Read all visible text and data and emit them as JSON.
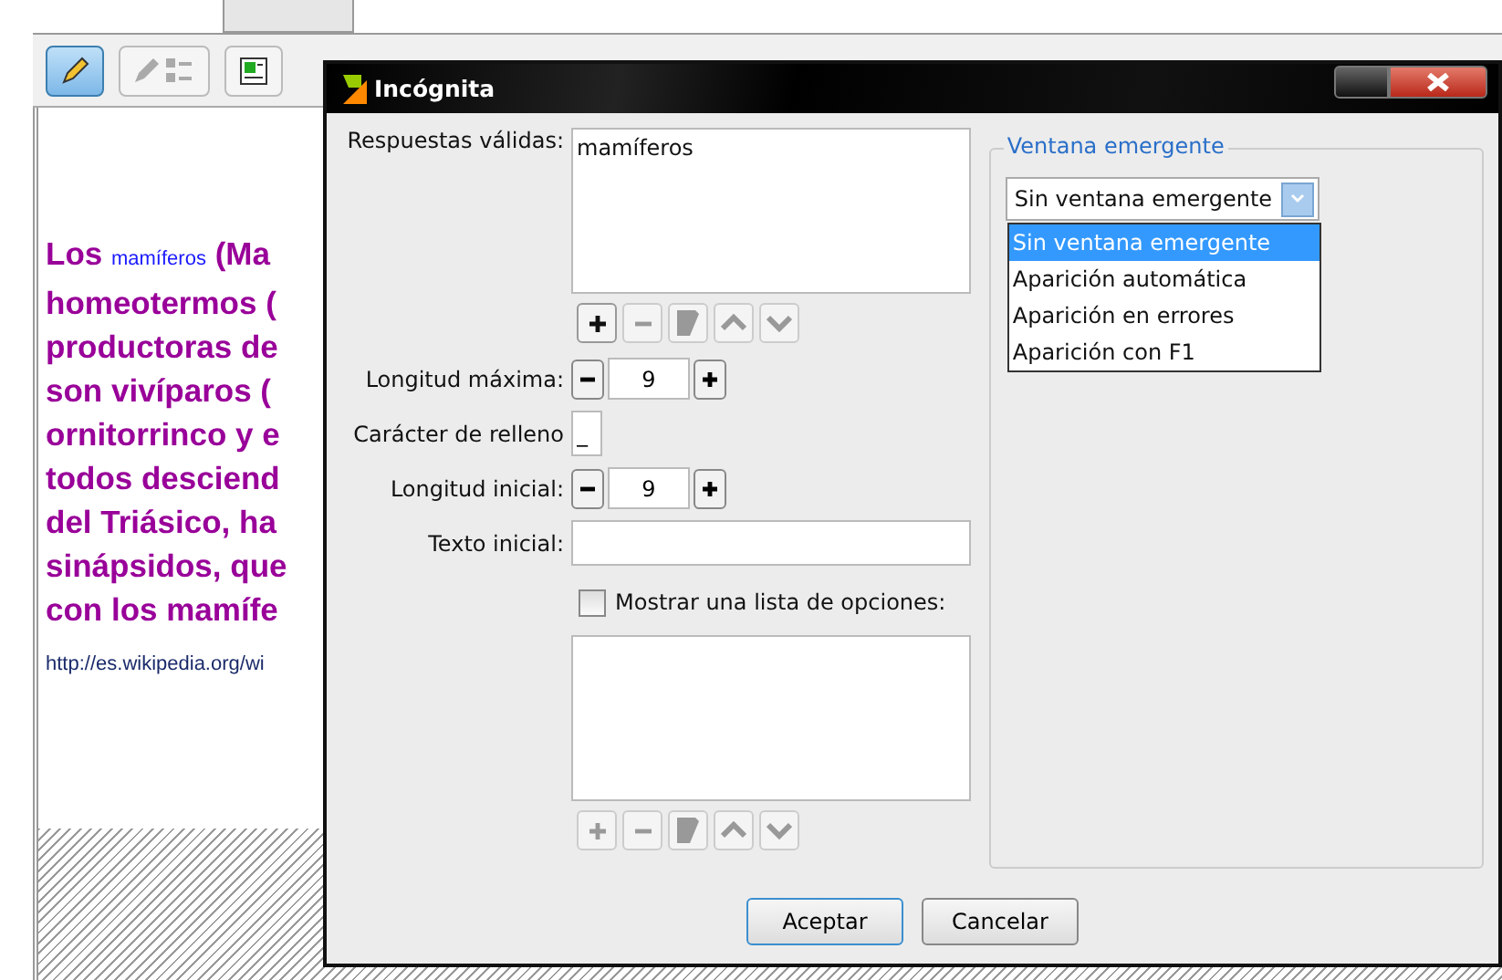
{
  "toolbar": [
    {
      "kind": "pencil",
      "selected": true
    },
    {
      "kind": "pencil-list",
      "selected": false
    },
    {
      "kind": "document",
      "selected": false
    }
  ],
  "document": {
    "lines": [
      [
        {
          "kind": "plain",
          "text": "Los "
        },
        {
          "kind": "link",
          "text": "mamíferos"
        },
        {
          "kind": "plain",
          "text": " (Ma"
        }
      ],
      [
        {
          "kind": "plain",
          "text": "homeotermos ("
        }
      ],
      [
        {
          "kind": "plain",
          "text": "productoras de"
        }
      ],
      [
        {
          "kind": "plain",
          "text": "son vivíparos ("
        }
      ],
      [
        {
          "kind": "plain",
          "text": "ornitorrinco y e"
        }
      ],
      [
        {
          "kind": "plain",
          "text": "todos desciend"
        }
      ],
      [
        {
          "kind": "plain",
          "text": "del Triásico, ha"
        }
      ],
      [
        {
          "kind": "plain",
          "text": "sinápsidos, que"
        }
      ],
      [
        {
          "kind": "plain",
          "text": "con los mamífe"
        }
      ]
    ],
    "url": "http://es.wikipedia.org/wi"
  },
  "dialog": {
    "title": "Incógnita",
    "valid_answers": {
      "label": "Respuestas válidas:",
      "items": [
        "mamíferos"
      ],
      "tools": [
        {
          "kind": "add",
          "disabled": false
        },
        {
          "kind": "remove",
          "disabled": true
        },
        {
          "kind": "edit",
          "disabled": true
        },
        {
          "kind": "up",
          "disabled": true
        },
        {
          "kind": "down",
          "disabled": true
        }
      ]
    },
    "max_length": {
      "label": "Longitud máxima:",
      "value": "9"
    },
    "fill_char": {
      "label": "Carácter de relleno",
      "value": "_"
    },
    "initial_length": {
      "label": "Longitud inicial:",
      "value": "9"
    },
    "initial_text": {
      "label": "Texto inicial:"
    },
    "show_options": {
      "label": "Mostrar una lista de opciones:",
      "checked": false,
      "tools": [
        {
          "kind": "add",
          "disabled": true
        },
        {
          "kind": "remove",
          "disabled": true
        },
        {
          "kind": "edit",
          "disabled": true
        },
        {
          "kind": "up",
          "disabled": true
        },
        {
          "kind": "down",
          "disabled": true
        }
      ]
    },
    "popup": {
      "title": "Ventana emergente",
      "value": "Sin ventana emergente",
      "expanded": true,
      "options": [
        {
          "label": "Sin ventana emergente",
          "selected": true
        },
        {
          "label": "Aparición automática",
          "selected": false
        },
        {
          "label": "Aparición en errores",
          "selected": false
        },
        {
          "label": "Aparición con F1",
          "selected": false
        }
      ]
    },
    "buttons": [
      {
        "label": "Aceptar",
        "default": true
      },
      {
        "label": "Cancelar",
        "default": false
      }
    ]
  }
}
